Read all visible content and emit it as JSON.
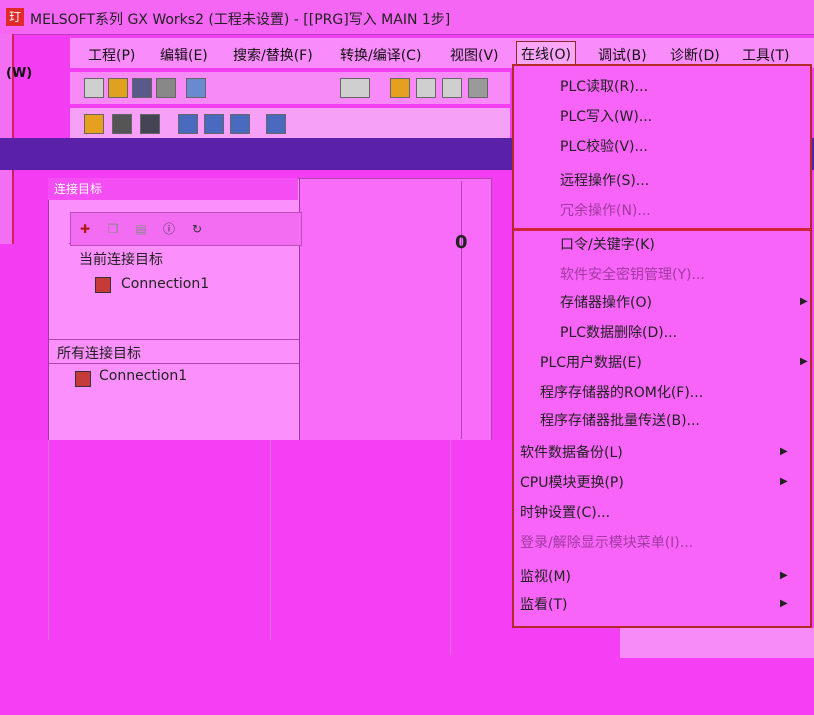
{
  "window": {
    "title": "MELSOFT系列 GX Works2 (工程未设置) - [[PRG]写入 MAIN 1步]",
    "icon_label": "玎"
  },
  "left_strip": {
    "label": "(W)"
  },
  "menubar": {
    "items": [
      {
        "label": "工程(P)"
      },
      {
        "label": "编辑(E)"
      },
      {
        "label": "搜索/替换(F)"
      },
      {
        "label": "转换/编译(C)"
      },
      {
        "label": "视图(V)"
      },
      {
        "label": "在线(O)"
      },
      {
        "label": "调试(B)"
      },
      {
        "label": "诊断(D)"
      },
      {
        "label": "工具(T)"
      }
    ]
  },
  "connection_panel": {
    "title": "连接目标",
    "current_label": "当前连接目标",
    "current_item": "Connection1",
    "all_label": "所有连接目标",
    "all_item": "Connection1"
  },
  "editor": {
    "step_number": "0"
  },
  "online_menu": {
    "items": [
      {
        "label": "PLC读取(R)...",
        "enabled": true,
        "submenu": false
      },
      {
        "label": "PLC写入(W)...",
        "enabled": true,
        "submenu": false
      },
      {
        "label": "PLC校验(V)...",
        "enabled": true,
        "submenu": false
      },
      {
        "label": "远程操作(S)...",
        "enabled": true,
        "submenu": false
      },
      {
        "label": "冗余操作(N)...",
        "enabled": false,
        "submenu": false
      },
      {
        "label": "口令/关键字(K)",
        "enabled": true,
        "submenu": true
      },
      {
        "label": "软件安全密钥管理(Y)...",
        "enabled": false,
        "submenu": false
      },
      {
        "label": "存储器操作(O)",
        "enabled": true,
        "submenu": true
      },
      {
        "label": "PLC数据删除(D)...",
        "enabled": true,
        "submenu": false
      },
      {
        "label": "PLC用户数据(E)",
        "enabled": true,
        "submenu": true
      },
      {
        "label": "程序存储器的ROM化(F)...",
        "enabled": true,
        "submenu": false
      },
      {
        "label": "程序存储器批量传送(B)...",
        "enabled": true,
        "submenu": false
      },
      {
        "label": "软件数据备份(L)",
        "enabled": true,
        "submenu": true
      },
      {
        "label": "CPU模块更换(P)",
        "enabled": true,
        "submenu": true
      },
      {
        "label": "时钟设置(C)...",
        "enabled": true,
        "submenu": false
      },
      {
        "label": "登录/解除显示模块菜单(I)...",
        "enabled": false,
        "submenu": false
      },
      {
        "label": "监视(M)",
        "enabled": true,
        "submenu": true
      },
      {
        "label": "监看(T)",
        "enabled": true,
        "submenu": true
      }
    ]
  },
  "colors": {
    "accent": "#b32a2a",
    "menu_bg": "#f864f8"
  }
}
